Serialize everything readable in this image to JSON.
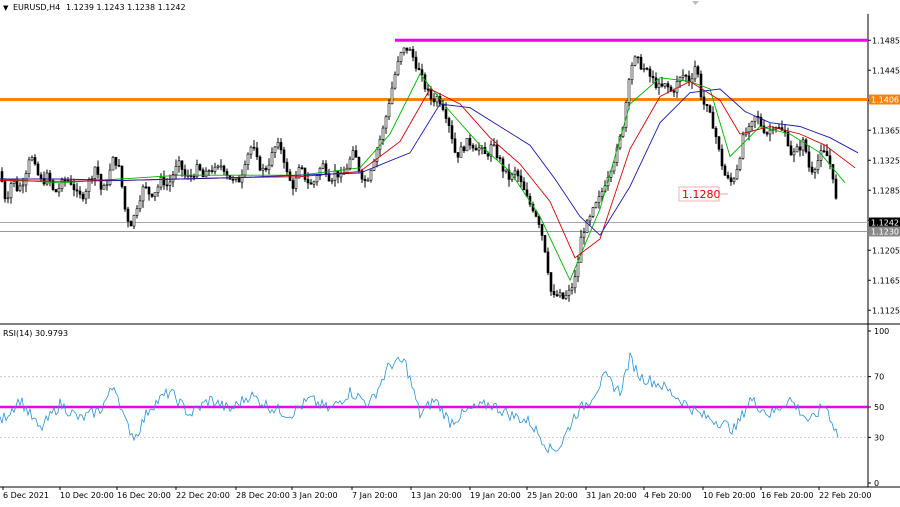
{
  "chart_data": [
    {
      "type": "candlestick",
      "title": "EURUSD,H4",
      "ohlc_text": "1.1239 1.1243 1.1238 1.1242",
      "ylim": [
        1.1108,
        1.152
      ],
      "y_ticks": [
        "1.1485",
        "1.1445",
        "1.1405",
        "1.1365",
        "1.1325",
        "1.1285",
        "1.1245",
        "1.1205",
        "1.1165",
        "1.1125"
      ],
      "x_ticks": [
        "6 Dec 2021",
        "10 Dec 20:00",
        "16 Dec 20:00",
        "22 Dec 20:00",
        "28 Dec 20:00",
        "3 Jan 20:00",
        "7 Jan 20:00",
        "13 Jan 20:00",
        "19 Jan 20:00",
        "25 Jan 20:00",
        "31 Jan 20:00",
        "4 Feb 20:00",
        "10 Feb 20:00",
        "16 Feb 20:00",
        "22 Feb 20:00"
      ],
      "close_path": [
        [
          0,
          1.131
        ],
        [
          6,
          1.127
        ],
        [
          12,
          1.13
        ],
        [
          18,
          1.1285
        ],
        [
          24,
          1.13
        ],
        [
          30,
          1.1335
        ],
        [
          36,
          1.131
        ],
        [
          42,
          1.1295
        ],
        [
          48,
          1.1305
        ],
        [
          54,
          1.128
        ],
        [
          60,
          1.129
        ],
        [
          66,
          1.13
        ],
        [
          72,
          1.1295
        ],
        [
          78,
          1.1275
        ],
        [
          84,
          1.128
        ],
        [
          90,
          1.13
        ],
        [
          96,
          1.132
        ],
        [
          102,
          1.128
        ],
        [
          108,
          1.13
        ],
        [
          114,
          1.133
        ],
        [
          120,
          1.131
        ],
        [
          126,
          1.125
        ],
        [
          132,
          1.124
        ],
        [
          138,
          1.127
        ],
        [
          144,
          1.129
        ],
        [
          150,
          1.128
        ],
        [
          156,
          1.1285
        ],
        [
          162,
          1.13
        ],
        [
          168,
          1.129
        ],
        [
          174,
          1.131
        ],
        [
          180,
          1.132
        ],
        [
          186,
          1.13
        ],
        [
          192,
          1.1305
        ],
        [
          198,
          1.1315
        ],
        [
          204,
          1.13
        ],
        [
          210,
          1.1315
        ],
        [
          216,
          1.131
        ],
        [
          222,
          1.132
        ],
        [
          228,
          1.1305
        ],
        [
          234,
          1.1295
        ],
        [
          240,
          1.13
        ],
        [
          246,
          1.133
        ],
        [
          252,
          1.1345
        ],
        [
          258,
          1.132
        ],
        [
          264,
          1.131
        ],
        [
          270,
          1.1325
        ],
        [
          276,
          1.1345
        ],
        [
          282,
          1.134
        ],
        [
          288,
          1.13
        ],
        [
          294,
          1.129
        ],
        [
          300,
          1.1315
        ],
        [
          306,
          1.13
        ],
        [
          312,
          1.129
        ],
        [
          318,
          1.131
        ],
        [
          324,
          1.132
        ],
        [
          330,
          1.13
        ],
        [
          336,
          1.131
        ],
        [
          342,
          1.13
        ],
        [
          348,
          1.132
        ],
        [
          354,
          1.1335
        ],
        [
          360,
          1.131
        ],
        [
          366,
          1.1295
        ],
        [
          372,
          1.132
        ],
        [
          378,
          1.1345
        ],
        [
          384,
          1.137
        ],
        [
          390,
          1.141
        ],
        [
          396,
          1.1445
        ],
        [
          402,
          1.147
        ],
        [
          408,
          1.1475
        ],
        [
          414,
          1.146
        ],
        [
          420,
          1.144
        ],
        [
          426,
          1.142
        ],
        [
          432,
          1.1405
        ],
        [
          438,
          1.141
        ],
        [
          444,
          1.1395
        ],
        [
          450,
          1.137
        ],
        [
          456,
          1.133
        ],
        [
          462,
          1.134
        ],
        [
          468,
          1.135
        ],
        [
          474,
          1.1345
        ],
        [
          480,
          1.134
        ],
        [
          486,
          1.133
        ],
        [
          492,
          1.1345
        ],
        [
          498,
          1.133
        ],
        [
          504,
          1.131
        ],
        [
          510,
          1.13
        ],
        [
          516,
          1.131
        ],
        [
          522,
          1.129
        ],
        [
          528,
          1.127
        ],
        [
          534,
          1.126
        ],
        [
          540,
          1.124
        ],
        [
          546,
          1.12
        ],
        [
          552,
          1.114
        ],
        [
          558,
          1.1145
        ],
        [
          564,
          1.114
        ],
        [
          570,
          1.115
        ],
        [
          576,
          1.117
        ],
        [
          582,
          1.123
        ],
        [
          588,
          1.124
        ],
        [
          594,
          1.126
        ],
        [
          600,
          1.1275
        ],
        [
          606,
          1.13
        ],
        [
          612,
          1.132
        ],
        [
          618,
          1.134
        ],
        [
          624,
          1.138
        ],
        [
          630,
          1.145
        ],
        [
          636,
          1.146
        ],
        [
          642,
          1.145
        ],
        [
          648,
          1.144
        ],
        [
          654,
          1.143
        ],
        [
          660,
          1.142
        ],
        [
          666,
          1.1425
        ],
        [
          672,
          1.1415
        ],
        [
          678,
          1.143
        ],
        [
          684,
          1.144
        ],
        [
          690,
          1.143
        ],
        [
          696,
          1.1455
        ],
        [
          702,
          1.1405
        ],
        [
          708,
          1.139
        ],
        [
          714,
          1.137
        ],
        [
          720,
          1.133
        ],
        [
          726,
          1.13
        ],
        [
          732,
          1.1295
        ],
        [
          738,
          1.132
        ],
        [
          744,
          1.136
        ],
        [
          750,
          1.1365
        ],
        [
          756,
          1.1385
        ],
        [
          762,
          1.137
        ],
        [
          768,
          1.136
        ],
        [
          774,
          1.1375
        ],
        [
          780,
          1.1365
        ],
        [
          786,
          1.136
        ],
        [
          792,
          1.133
        ],
        [
          798,
          1.134
        ],
        [
          804,
          1.135
        ],
        [
          810,
          1.131
        ],
        [
          816,
          1.132
        ],
        [
          822,
          1.1335
        ],
        [
          828,
          1.133
        ],
        [
          834,
          1.13
        ],
        [
          838,
          1.1242
        ]
      ],
      "moving_averages": [
        {
          "color": "#00b000",
          "values": [
            [
              0,
              1.13
            ],
            [
              60,
              1.1295
            ],
            [
              120,
              1.13
            ],
            [
              180,
              1.1305
            ],
            [
              240,
              1.1305
            ],
            [
              300,
              1.1305
            ],
            [
              360,
              1.1315
            ],
            [
              390,
              1.136
            ],
            [
              420,
              1.144
            ],
            [
              450,
              1.139
            ],
            [
              480,
              1.1345
            ],
            [
              510,
              1.131
            ],
            [
              540,
              1.125
            ],
            [
              570,
              1.1165
            ],
            [
              600,
              1.126
            ],
            [
              630,
              1.14
            ],
            [
              660,
              1.1435
            ],
            [
              690,
              1.143
            ],
            [
              710,
              1.142
            ],
            [
              730,
              1.133
            ],
            [
              760,
              1.137
            ],
            [
              790,
              1.136
            ],
            [
              820,
              1.1335
            ],
            [
              845,
              1.1295
            ]
          ]
        },
        {
          "color": "#d00000",
          "values": [
            [
              0,
              1.1298
            ],
            [
              60,
              1.1297
            ],
            [
              120,
              1.1298
            ],
            [
              180,
              1.13
            ],
            [
              240,
              1.1302
            ],
            [
              300,
              1.1303
            ],
            [
              360,
              1.131
            ],
            [
              400,
              1.135
            ],
            [
              430,
              1.142
            ],
            [
              460,
              1.14
            ],
            [
              490,
              1.1355
            ],
            [
              520,
              1.132
            ],
            [
              550,
              1.127
            ],
            [
              575,
              1.1195
            ],
            [
              600,
              1.122
            ],
            [
              630,
              1.134
            ],
            [
              660,
              1.141
            ],
            [
              690,
              1.143
            ],
            [
              720,
              1.1405
            ],
            [
              740,
              1.136
            ],
            [
              770,
              1.137
            ],
            [
              800,
              1.136
            ],
            [
              825,
              1.1345
            ],
            [
              855,
              1.1315
            ]
          ]
        },
        {
          "color": "#1a1aaa",
          "values": [
            [
              0,
              1.13
            ],
            [
              60,
              1.13
            ],
            [
              120,
              1.1298
            ],
            [
              180,
              1.13
            ],
            [
              240,
              1.1302
            ],
            [
              300,
              1.1305
            ],
            [
              360,
              1.1308
            ],
            [
              410,
              1.1335
            ],
            [
              440,
              1.14
            ],
            [
              470,
              1.1395
            ],
            [
              500,
              1.137
            ],
            [
              530,
              1.1345
            ],
            [
              555,
              1.13
            ],
            [
              580,
              1.125
            ],
            [
              600,
              1.1225
            ],
            [
              630,
              1.129
            ],
            [
              660,
              1.1375
            ],
            [
              690,
              1.1415
            ],
            [
              720,
              1.142
            ],
            [
              745,
              1.139
            ],
            [
              770,
              1.1375
            ],
            [
              800,
              1.137
            ],
            [
              830,
              1.1355
            ],
            [
              858,
              1.1335
            ]
          ]
        }
      ],
      "horizontal_levels": [
        {
          "value": 1.1485,
          "color": "#ee00ee",
          "label": "",
          "x_start": 395
        },
        {
          "value": 1.1406,
          "color": "#f5840c",
          "label": "1.1406",
          "x_start": 0
        },
        {
          "value": 1.1242,
          "color": "#aaaaaa",
          "label": "1.1242",
          "x_start": 0
        },
        {
          "value": 1.123,
          "color": "#999999",
          "label": "1.1230",
          "x_start": 0
        }
      ],
      "annotation": {
        "text": "1.1280",
        "value": 1.128,
        "color": "#e00000"
      },
      "last_price": 1.1242
    },
    {
      "type": "line",
      "title": "RSI(14) 30.9793",
      "ylim": [
        0,
        100
      ],
      "y_ticks": [
        "100",
        "70",
        "50",
        "30",
        "0"
      ],
      "levels": [
        70,
        50,
        30
      ],
      "highlight_level": {
        "value": 50,
        "color": "#ee00ee"
      },
      "series": [
        {
          "color": "#2a8fd6",
          "values": [
            [
              0,
              40
            ],
            [
              20,
              55
            ],
            [
              40,
              35
            ],
            [
              60,
              52
            ],
            [
              80,
              42
            ],
            [
              100,
              48
            ],
            [
              115,
              65
            ],
            [
              125,
              40
            ],
            [
              135,
              30
            ],
            [
              150,
              50
            ],
            [
              170,
              60
            ],
            [
              190,
              45
            ],
            [
              210,
              55
            ],
            [
              230,
              48
            ],
            [
              250,
              58
            ],
            [
              270,
              50
            ],
            [
              290,
              45
            ],
            [
              310,
              55
            ],
            [
              330,
              48
            ],
            [
              350,
              60
            ],
            [
              370,
              52
            ],
            [
              390,
              78
            ],
            [
              405,
              80
            ],
            [
              420,
              45
            ],
            [
              435,
              55
            ],
            [
              450,
              40
            ],
            [
              470,
              48
            ],
            [
              490,
              52
            ],
            [
              510,
              45
            ],
            [
              530,
              40
            ],
            [
              550,
              22
            ],
            [
              560,
              24
            ],
            [
              575,
              45
            ],
            [
              590,
              55
            ],
            [
              605,
              70
            ],
            [
              620,
              60
            ],
            [
              630,
              82
            ],
            [
              640,
              70
            ],
            [
              660,
              65
            ],
            [
              680,
              55
            ],
            [
              700,
              45
            ],
            [
              720,
              40
            ],
            [
              735,
              35
            ],
            [
              750,
              55
            ],
            [
              770,
              45
            ],
            [
              790,
              55
            ],
            [
              810,
              40
            ],
            [
              825,
              52
            ],
            [
              838,
              31
            ]
          ]
        }
      ]
    }
  ],
  "colors": {
    "background": "#ffffff",
    "bull_candle": "#ffffff",
    "bear_candle": "#000000",
    "axis_line": "#000000"
  },
  "header": {
    "menu_marker": "▼",
    "symbol_text": "EURUSD,H4",
    "ohlc_text": "1.1239 1.1243 1.1238 1.1242"
  },
  "rsi_header": {
    "text": "RSI(14) 30.9793"
  }
}
